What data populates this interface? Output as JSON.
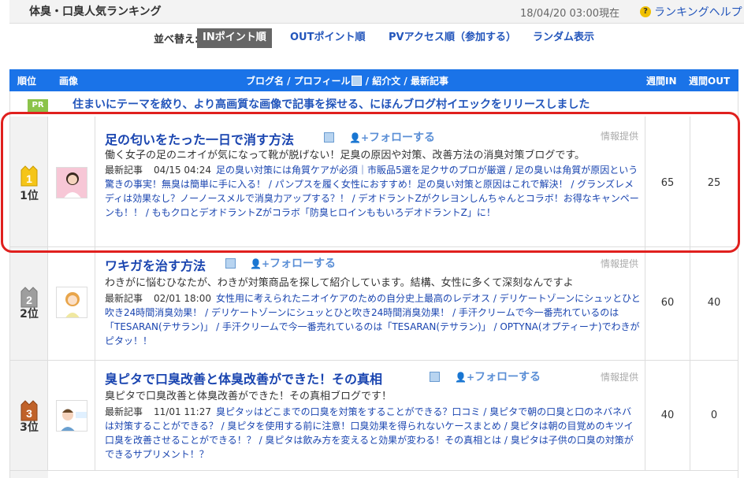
{
  "header": {
    "title": "体臭・口臭人気ランキング",
    "date": "18/04/20 03:00現在",
    "help_icon": "?",
    "help_label": "ランキングヘルプ"
  },
  "sort": {
    "label": "並べ替え:",
    "options": [
      "INポイント順",
      "OUTポイント順",
      "PVアクセス順（参加する）",
      "ランダム表示"
    ],
    "active": "INポイント順"
  },
  "table_header": {
    "rank": "順位",
    "image": "画像",
    "main_prefix": "ブログ名 / プロフィール",
    "main_suffix": " / 紹介文 / 最新記事",
    "in": "週間IN",
    "out": "週間OUT"
  },
  "notice": {
    "badge": "PR",
    "text": "住まいにテーマを絞り、より高画質な画像で記事を探せる、にほんブログ村イエックをリリースしました"
  },
  "rows": [
    {
      "rank_number": "1",
      "rank_label": "1位",
      "medal_color": "#f5c518",
      "title": "足の匂いをたった一日で消す方法",
      "follow": "フォローする",
      "info": "情報提供",
      "description": "働く女子の足のニオイが気になって靴が脱げない！足臭の原因や対策、改善方法の消臭対策ブログです。",
      "latest_label": "最新記事",
      "latest_time": "04/15 04:24",
      "latest_articles": "足の臭い対策には角質ケアが必須｜市販品5選を足クサのプロが厳選 / 足の臭いは角質が原因という驚きの事実！無臭は簡単に手に入る！ / パンプスを履く女性におすすめ！足の臭い対策と原因はこれで解決！ / グランズレメディは効果なし？ノーノースメルで消臭力アップする？！ / デオドラントZがクレヨンしんちゃんとコラボ！お得なキャンペーンも！！ / ももクロとデオドラントZがコラボ「防臭ヒロインももいろデオドラントZ」に！",
      "in": "65",
      "out": "25"
    },
    {
      "rank_number": "2",
      "rank_label": "2位",
      "medal_color": "#9e9e9e",
      "title": "ワキガを治す方法",
      "follow": "フォローする",
      "info": "情報提供",
      "description": "わきがに悩むひなたが、わきが対策商品を探して紹介しています。結構、女性に多くて深刻なんですよ",
      "latest_label": "最新記事",
      "latest_time": "02/01 18:00",
      "latest_articles": "女性用に考えられたニオイケアのための自分史上最高のレデオス / デリケートゾーンにシュッとひと吹き24時間消臭効果！ / デリケートゾーンにシュッとひと吹き24時間消臭効果！ / 手汗クリームで今一番売れているのは「TESARAN(テサラン)」 / 手汗クリームで今一番売れているのは「TESARAN(テサラン)」 / OPTYNA(オプティーナ)でわきがピタッ！！",
      "in": "60",
      "out": "40"
    },
    {
      "rank_number": "3",
      "rank_label": "3位",
      "medal_color": "#c0622a",
      "title": "臭ピタで口臭改善と体臭改善ができた！その真相",
      "follow": "フォローする",
      "info": "情報提供",
      "description": "臭ピタで口臭改善と体臭改善ができた！その真相ブログです！",
      "latest_label": "最新記事",
      "latest_time": "11/01 11:27",
      "latest_articles": "臭ピタッはどこまでの口臭を対策をすることができる？口コミ / 臭ピタで朝の口臭と口のネバネバは対策することができる？ / 臭ピタを使用する前に注意！口臭効果を得られないケースまとめ / 臭ピタは朝の目覚めのキツイ口臭を改善させることができる！？ / 臭ピタは飲み方を変えると効果が変わる！その真相とは / 臭ピタは子供の口臭の対策ができるサプリメント！？",
      "in": "40",
      "out": "0"
    }
  ]
}
